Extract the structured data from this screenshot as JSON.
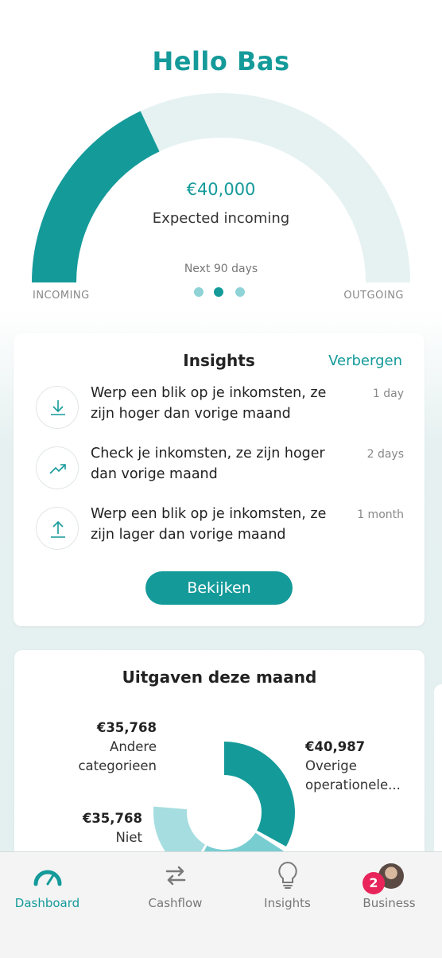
{
  "greeting": "Hello Bas",
  "gauge": {
    "amount": "€40,000",
    "label": "Expected incoming",
    "period": "Next 90 days",
    "left_label": "INCOMING",
    "right_label": "OUTGOING",
    "incoming_fraction": 0.36,
    "page_count": 3,
    "active_page": 2
  },
  "insights": {
    "title": "Insights",
    "hide_label": "Verbergen",
    "items": [
      {
        "icon": "download-icon",
        "text": "Werp een blik op je inkomsten, ze zijn hoger dan vorige maand",
        "time": "1 day"
      },
      {
        "icon": "trend-up-icon",
        "text": "Check je inkomsten, ze zijn hoger dan vorige maand",
        "time": "2 days"
      },
      {
        "icon": "upload-icon",
        "text": "Werp een blik op je inkomsten, ze zijn lager dan vorige maand",
        "time": "1 month"
      }
    ],
    "button_label": "Bekijken"
  },
  "expenses": {
    "title": "Uitgaven deze maand",
    "segments": [
      {
        "amount": "€40,987",
        "label_line1": "Overige",
        "label_line2": "operationele..."
      },
      {
        "amount": "€35,768",
        "label_line1": "Andere",
        "label_line2": "categorieen"
      },
      {
        "amount": "€35,768",
        "label_line1": "Niet",
        "label_line2": ""
      }
    ]
  },
  "nav": {
    "items": [
      {
        "label": "Dashboard",
        "icon": "speedometer-icon",
        "active": true
      },
      {
        "label": "Cashflow",
        "icon": "transfer-arrows-icon",
        "active": false
      },
      {
        "label": "Insights",
        "icon": "lightbulb-icon",
        "active": false
      },
      {
        "label": "Business",
        "icon": "avatar",
        "active": false
      }
    ],
    "business_badge": "2"
  },
  "colors": {
    "accent": "#159a9a",
    "light_accent": "#8fd3d6",
    "badge": "#e8245a"
  }
}
